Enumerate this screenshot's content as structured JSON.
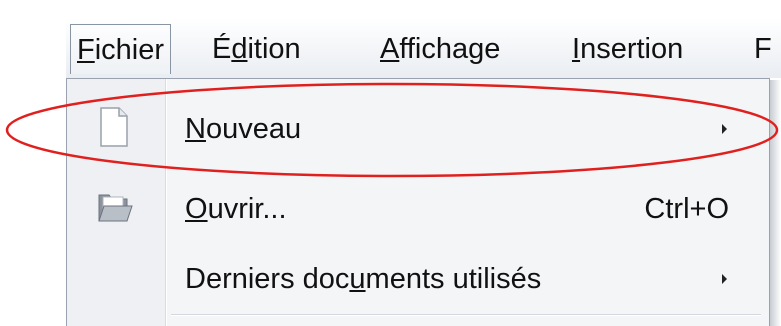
{
  "menubar": {
    "items": [
      {
        "mnemonic": "F",
        "rest": "ichier"
      },
      {
        "pre": "É",
        "mnemonic": "d",
        "rest": "ition"
      },
      {
        "mnemonic": "A",
        "rest": "ffichage"
      },
      {
        "mnemonic": "I",
        "rest": "nsertion"
      },
      {
        "label": "F"
      }
    ]
  },
  "menu": {
    "items": [
      {
        "mnemonic": "N",
        "rest": "ouveau",
        "icon": "new-document-icon",
        "has_submenu": true
      },
      {
        "mnemonic": "O",
        "rest": "uvrir...",
        "shortcut": "Ctrl+O",
        "icon": "open-folder-icon"
      },
      {
        "pre": "Derniers doc",
        "mnemonic": "u",
        "rest": "ments utilisés",
        "has_submenu": true
      }
    ]
  },
  "annotation": {
    "color": "#e0201e",
    "target": "Nouveau"
  }
}
